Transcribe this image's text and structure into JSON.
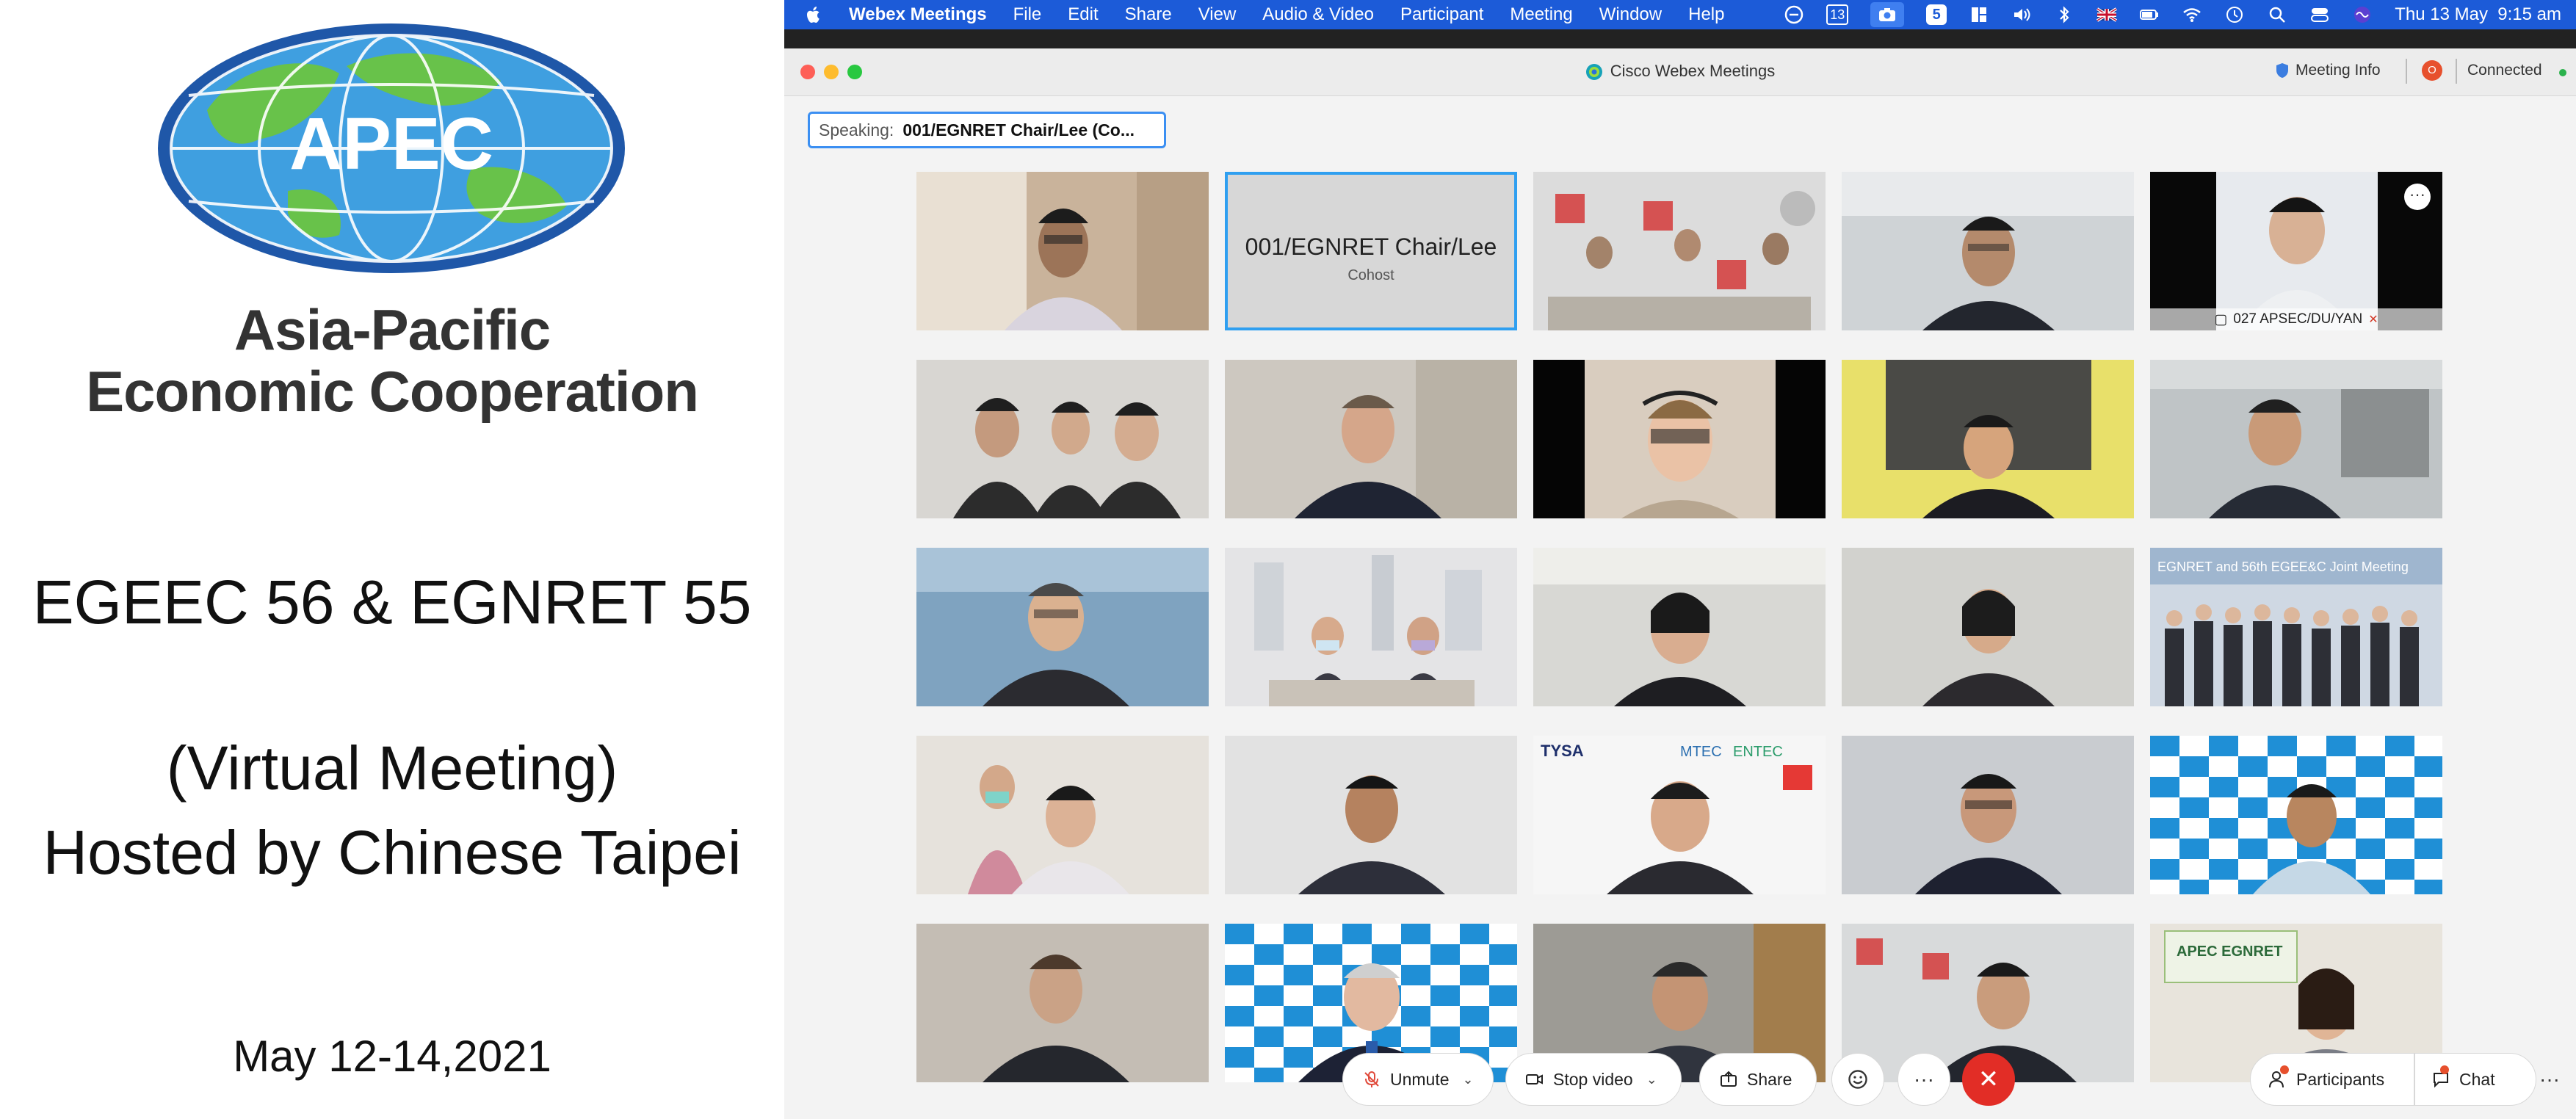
{
  "slide": {
    "org_line1": "Asia-Pacific",
    "org_line2": "Economic Cooperation",
    "logo_text": "APEC",
    "title": "EGEEC 56 & EGNRET 55",
    "virtual": "(Virtual Meeting)",
    "host": "Hosted by Chinese Taipei",
    "dates": "May 12-14,2021"
  },
  "menubar": {
    "app_name": "Webex Meetings",
    "items": [
      "File",
      "Edit",
      "Share",
      "View",
      "Audio & Video",
      "Participant",
      "Meeting",
      "Window",
      "Help"
    ],
    "status_badge_number": "13",
    "status_five": "5",
    "battery_icon": "battery-icon",
    "datetime": "Thu 13 May  9:15 am"
  },
  "window": {
    "title": "Cisco Webex Meetings",
    "meeting_info": "Meeting Info",
    "recording_badge": "O",
    "connection_status": "Connected",
    "speaking_label": "Speaking:",
    "speaking_name": "001/EGNRET Chair/Lee (Co..."
  },
  "tiles": {
    "host_name": "001/EGNRET Chair/Lee",
    "host_role": "Cohost",
    "t5_name": "027 APSEC/DU/YAN",
    "t18_brand1": "TYSA",
    "t18_brand2": "MTEC",
    "t18_brand3": "ENTEC",
    "t15_banner": "EGNRET and 56th EGEE&C Joint Meeting",
    "t25_banner": "APEC EGNRET",
    "repeat_logo": "APEC"
  },
  "controls": {
    "unmute": "Unmute",
    "stop_video": "Stop video",
    "share": "Share",
    "participants": "Participants",
    "chat": "Chat"
  },
  "colors": {
    "menubar": "#1c5bd8",
    "leave": "#e22d26",
    "active_border": "#2f9ff0"
  }
}
